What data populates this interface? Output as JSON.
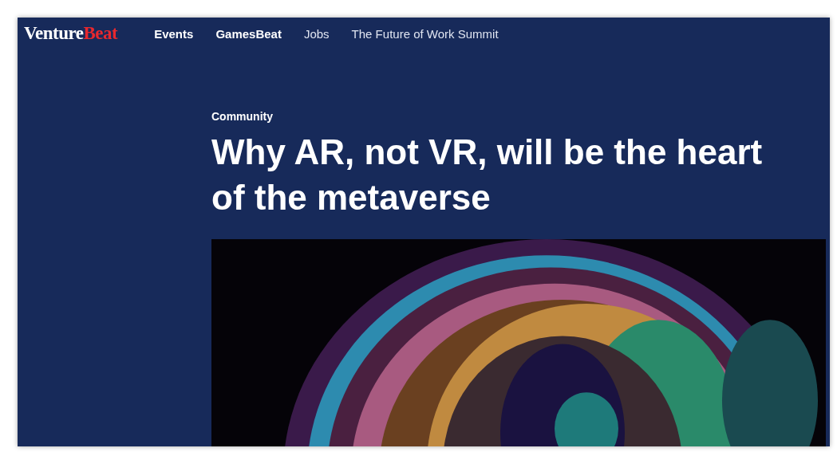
{
  "logo": {
    "first": "Venture",
    "second": "Beat"
  },
  "nav": [
    {
      "label": "Events",
      "emphasized": true
    },
    {
      "label": "GamesBeat",
      "emphasized": true
    },
    {
      "label": "Jobs",
      "emphasized": false
    },
    {
      "label": "The Future of Work Summit",
      "emphasized": false
    }
  ],
  "article": {
    "category": "Community",
    "headline": "Why AR, not VR, will be the heart of the metaverse"
  }
}
